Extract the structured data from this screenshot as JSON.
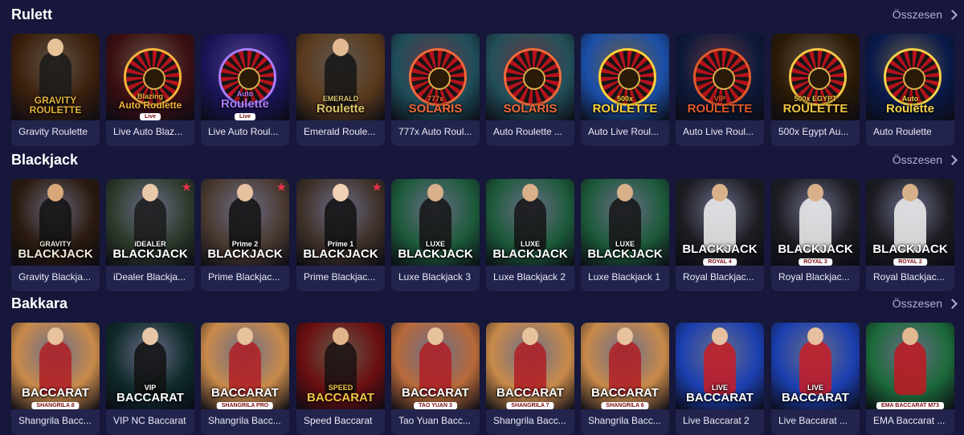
{
  "sections": [
    {
      "title": "Rulett",
      "see_all": "Összesen",
      "cards": [
        {
          "label": "Gravity Roulette",
          "logo_top": "",
          "logo_main": "GRAVITY ROULETTE",
          "sub": "",
          "bg": "#3b1f0c",
          "accent": "#e0b23a",
          "art": "dealer",
          "skin": "#e7c39a",
          "dress": "#1a1a1a",
          "star": false
        },
        {
          "label": "Live Auto Blaz...",
          "logo_top": "Blazing",
          "logo_main": "Auto Roulette",
          "sub": "Live",
          "bg": "#3a0f12",
          "accent": "#f4b53c",
          "art": "wheel",
          "skin": "",
          "dress": "",
          "star": false
        },
        {
          "label": "Live Auto Roul...",
          "logo_top": "Auto",
          "logo_main": "Roulette",
          "sub": "Live",
          "bg": "#1a1458",
          "accent": "#a97dff",
          "art": "wheel",
          "skin": "",
          "dress": "",
          "star": false
        },
        {
          "label": "Emerald Roule...",
          "logo_top": "EMERALD",
          "logo_main": "Roulette",
          "sub": "",
          "bg": "#5a3a1c",
          "accent": "#d9c36a",
          "art": "dealer",
          "skin": "#e2bb93",
          "dress": "#151515",
          "star": false
        },
        {
          "label": "777x Auto Roul...",
          "logo_top": "777x",
          "logo_main": "SOLARIS",
          "sub": "",
          "bg": "#1f4e5a",
          "accent": "#f06a3a",
          "art": "wheel",
          "skin": "",
          "dress": "",
          "star": false
        },
        {
          "label": "Auto Roulette ...",
          "logo_top": "",
          "logo_main": "SOLARIS",
          "sub": "",
          "bg": "#23505a",
          "accent": "#f06a3a",
          "art": "wheel",
          "skin": "",
          "dress": "",
          "star": false
        },
        {
          "label": "Auto Live Roul...",
          "logo_top": "500x",
          "logo_main": "ROULETTE",
          "sub": "",
          "bg": "#1b4fa8",
          "accent": "#ffd23a",
          "art": "wheel",
          "skin": "",
          "dress": "",
          "star": false
        },
        {
          "label": "Auto Live Roul...",
          "logo_top": "VIP",
          "logo_main": "ROULETTE",
          "sub": "",
          "bg": "#0e1a3a",
          "accent": "#e05a2a",
          "art": "wheel",
          "skin": "",
          "dress": "",
          "star": false
        },
        {
          "label": "500x Egypt Au...",
          "logo_top": "500x EGYPT",
          "logo_main": "ROULETTE",
          "sub": "",
          "bg": "#2a1a06",
          "accent": "#f2c744",
          "art": "wheel",
          "skin": "",
          "dress": "",
          "star": false
        },
        {
          "label": "Auto Roulette",
          "logo_top": "Auto",
          "logo_main": "Roulette",
          "sub": "",
          "bg": "#0a1a4a",
          "accent": "#f2d24a",
          "art": "wheel",
          "skin": "",
          "dress": "",
          "star": false
        }
      ]
    },
    {
      "title": "Blackjack",
      "see_all": "Összesen",
      "cards": [
        {
          "label": "Gravity Blackja...",
          "logo_top": "GRAVITY",
          "logo_main": "BLACKJACK",
          "sub": "",
          "bg": "#2a1a0e",
          "accent": "#f0e7d6",
          "art": "dealer",
          "skin": "#d9a879",
          "dress": "#111111",
          "star": false
        },
        {
          "label": "iDealer Blackja...",
          "logo_top": "iDEALER",
          "logo_main": "BLACKJACK",
          "sub": "",
          "bg": "#2c3a2a",
          "accent": "#ffffff",
          "art": "dealer",
          "skin": "#e8c9aa",
          "dress": "#1a1a1a",
          "star": true
        },
        {
          "label": "Prime Blackjac...",
          "logo_top": "Prime 2",
          "logo_main": "BLACKJACK",
          "sub": "",
          "bg": "#4a3a30",
          "accent": "#ffffff",
          "art": "dealer",
          "skin": "#e6c2a0",
          "dress": "#101010",
          "star": true
        },
        {
          "label": "Prime Blackjac...",
          "logo_top": "Prime 1",
          "logo_main": "BLACKJACK",
          "sub": "",
          "bg": "#3e3028",
          "accent": "#ffffff",
          "art": "dealer",
          "skin": "#f0d2b4",
          "dress": "#101010",
          "star": true
        },
        {
          "label": "Luxe Blackjack 3",
          "logo_top": "LUXE",
          "logo_main": "BLACKJACK",
          "sub": "",
          "bg": "#1c5a3a",
          "accent": "#ffffff",
          "art": "dealer",
          "skin": "#d8b08a",
          "dress": "#141414",
          "star": false
        },
        {
          "label": "Luxe Blackjack 2",
          "logo_top": "LUXE",
          "logo_main": "BLACKJACK",
          "sub": "",
          "bg": "#1c5a3a",
          "accent": "#ffffff",
          "art": "dealer",
          "skin": "#d8b08a",
          "dress": "#141414",
          "star": false
        },
        {
          "label": "Luxe Blackjack 1",
          "logo_top": "LUXE",
          "logo_main": "BLACKJACK",
          "sub": "",
          "bg": "#1c5a3a",
          "accent": "#ffffff",
          "art": "dealer",
          "skin": "#d8b08a",
          "dress": "#141414",
          "star": false
        },
        {
          "label": "Royal Blackjac...",
          "logo_top": "",
          "logo_main": "BLACKJACK",
          "sub": "ROYAL 4",
          "bg": "#1c1c22",
          "accent": "#ffffff",
          "art": "dealer",
          "skin": "#d8b08a",
          "dress": "#f2f2f2",
          "star": false
        },
        {
          "label": "Royal Blackjac...",
          "logo_top": "",
          "logo_main": "BLACKJACK",
          "sub": "ROYAL 3",
          "bg": "#1c1c22",
          "accent": "#ffffff",
          "art": "dealer",
          "skin": "#d8b08a",
          "dress": "#f2f2f2",
          "star": false
        },
        {
          "label": "Royal Blackjac...",
          "logo_top": "",
          "logo_main": "BLACKJACK",
          "sub": "ROYAL 2",
          "bg": "#1c1c22",
          "accent": "#ffffff",
          "art": "dealer",
          "skin": "#d8b08a",
          "dress": "#f2f2f2",
          "star": false
        }
      ]
    },
    {
      "title": "Bakkara",
      "see_all": "Összesen",
      "cards": [
        {
          "label": "Shangrila Bacc...",
          "logo_top": "",
          "logo_main": "BACCARAT",
          "sub": "SHANGRILA 8",
          "bg": "#c98a4a",
          "accent": "#ffffff",
          "art": "dealer",
          "skin": "#e8c29c",
          "dress": "#b01e24",
          "star": false
        },
        {
          "label": "VIP NC Baccarat",
          "logo_top": "VIP",
          "logo_main": "BACCARAT",
          "sub": "",
          "bg": "#0f2a2a",
          "accent": "#ffffff",
          "art": "dealer",
          "skin": "#e6c6a6",
          "dress": "#101010",
          "star": false
        },
        {
          "label": "Shangrila Bacc...",
          "logo_top": "",
          "logo_main": "BACCARAT",
          "sub": "SHANGRILA PRO",
          "bg": "#c98a4a",
          "accent": "#ffffff",
          "art": "dealer",
          "skin": "#e8c29c",
          "dress": "#b01e24",
          "star": false
        },
        {
          "label": "Speed Baccarat",
          "logo_top": "SPEED",
          "logo_main": "BACCARAT",
          "sub": "",
          "bg": "#6a0e10",
          "accent": "#f2c744",
          "art": "dealer",
          "skin": "#e2b48a",
          "dress": "#1a1010",
          "star": false
        },
        {
          "label": "Tao Yuan Bacc...",
          "logo_top": "",
          "logo_main": "BACCARAT",
          "sub": "TAO YUAN 3",
          "bg": "#b86a3a",
          "accent": "#ffffff",
          "art": "dealer",
          "skin": "#e8c29c",
          "dress": "#b01e24",
          "star": false
        },
        {
          "label": "Shangrila Bacc...",
          "logo_top": "",
          "logo_main": "BACCARAT",
          "sub": "SHANGRILA 7",
          "bg": "#c98a4a",
          "accent": "#ffffff",
          "art": "dealer",
          "skin": "#e8c29c",
          "dress": "#b01e24",
          "star": false
        },
        {
          "label": "Shangrila Bacc...",
          "logo_top": "",
          "logo_main": "BACCARAT",
          "sub": "SHANGRILA 6",
          "bg": "#c98a4a",
          "accent": "#ffffff",
          "art": "dealer",
          "skin": "#e8c29c",
          "dress": "#b01e24",
          "star": false
        },
        {
          "label": "Live Baccarat 2",
          "logo_top": "LIVE",
          "logo_main": "BACCARAT",
          "sub": "",
          "bg": "#1b3fb0",
          "accent": "#ffffff",
          "art": "dealer",
          "skin": "#e6c0a0",
          "dress": "#c81c24",
          "star": false
        },
        {
          "label": "Live Baccarat ...",
          "logo_top": "LIVE",
          "logo_main": "BACCARAT",
          "sub": "",
          "bg": "#1b3fb0",
          "accent": "#ffffff",
          "art": "dealer",
          "skin": "#e6c0a0",
          "dress": "#c81c24",
          "star": false
        },
        {
          "label": "EMA Baccarat ...",
          "logo_top": "",
          "logo_main": "",
          "sub": "EMA BACCARAT M73",
          "bg": "#1c6a3a",
          "accent": "#ffffff",
          "art": "dealer",
          "skin": "#e2b890",
          "dress": "#c01820",
          "star": false
        }
      ]
    }
  ]
}
